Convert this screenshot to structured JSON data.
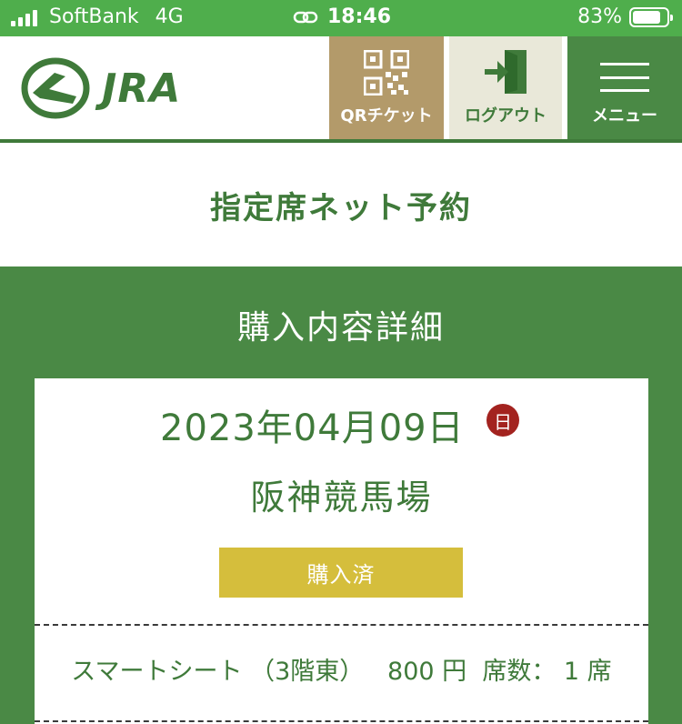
{
  "status_bar": {
    "carrier": "SoftBank",
    "network": "4G",
    "time": "18:46",
    "battery_pct": "83%",
    "battery_level": 0.83
  },
  "header": {
    "logo_text": "JRA",
    "qr_label": "QRチケット",
    "logout_label": "ログアウト",
    "menu_label": "メニュー"
  },
  "page": {
    "title": "指定席ネット予約"
  },
  "panel": {
    "title": "購入内容詳細",
    "date": "2023年04月09日",
    "day_of_week": "日",
    "venue": "阪神競馬場",
    "status": "購入済",
    "seat": {
      "type": "スマートシート",
      "floor": "（3階東）",
      "price": "800 円",
      "count_label": "席数：",
      "count": "1 席"
    }
  },
  "colors": {
    "status_bar_bg": "#4fae4c",
    "brand_green": "#3f7a3a",
    "panel_green": "#4a8945",
    "qr_button_bg": "#b39a6a",
    "logout_button_bg": "#e9e8d9",
    "status_badge_bg": "#d5be3c",
    "day_badge_bg": "#a3231f"
  }
}
